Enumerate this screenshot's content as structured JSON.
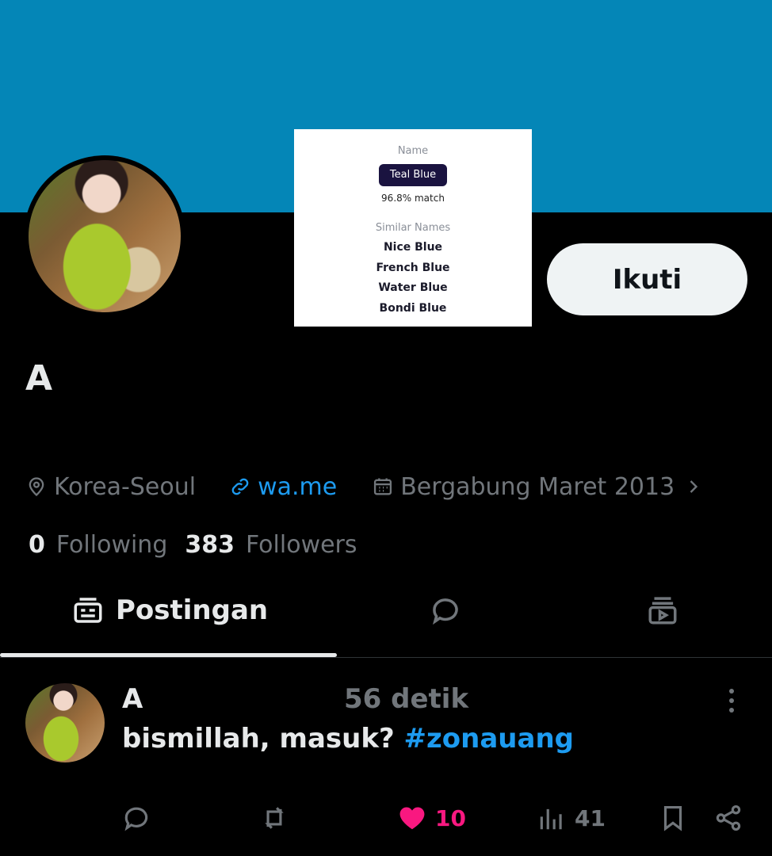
{
  "profile": {
    "display_name": "A",
    "location": "Korea-Seoul",
    "link": "wa.me",
    "joined": "Bergabung Maret 2013",
    "following_count": "0",
    "following_label": "Following",
    "followers_count": "383",
    "followers_label": "Followers",
    "follow_button": "Ikuti"
  },
  "color_card": {
    "name_label": "Name",
    "name": "Teal Blue",
    "match": "96.8% match",
    "similar_label": "Similar Names",
    "similar": [
      "Nice Blue",
      "French Blue",
      "Water Blue",
      "Bondi Blue"
    ],
    "swatch": "#0486b7"
  },
  "tabs": {
    "posts_label": "Postingan",
    "icons": [
      "posts-icon",
      "replies-icon",
      "media-icon"
    ]
  },
  "post": {
    "author": "A",
    "time": "56 detik",
    "text": "bismillah, masuk? ",
    "hashtag": "#zonauang",
    "like_count": "10",
    "view_count": "41"
  },
  "colors": {
    "banner": "#0486b7",
    "background": "#000000",
    "accent": "#1d9bf0",
    "like": "#f91880",
    "muted": "#71767b"
  }
}
